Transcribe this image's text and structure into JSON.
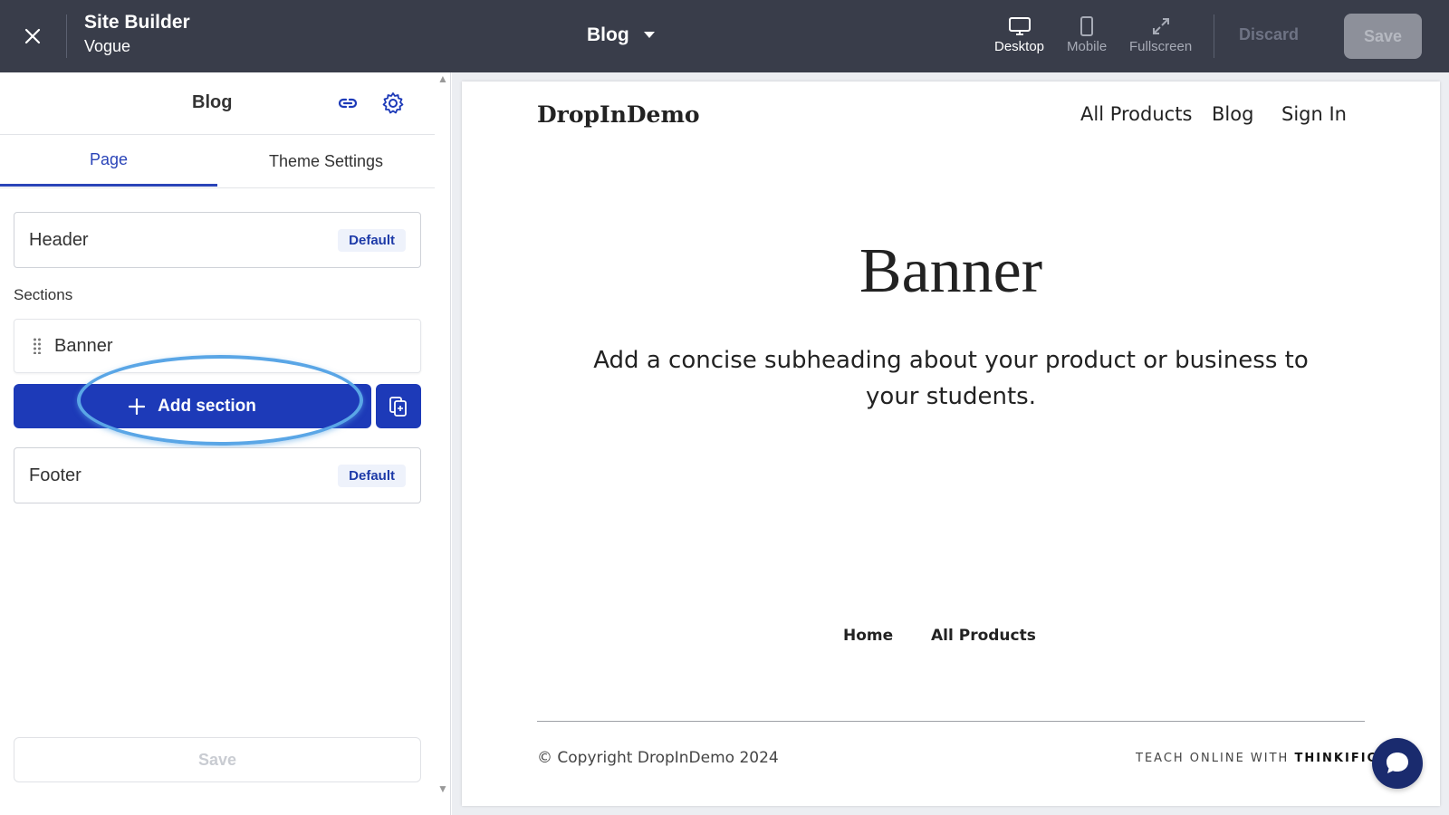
{
  "topbar": {
    "title": "Site Builder",
    "subtitle": "Vogue",
    "current_page": "Blog",
    "views": {
      "desktop": "Desktop",
      "mobile": "Mobile",
      "fullscreen": "Fullscreen"
    },
    "discard_label": "Discard",
    "save_label": "Save"
  },
  "panel": {
    "title": "Blog",
    "tabs": {
      "page": "Page",
      "theme": "Theme Settings"
    },
    "header": {
      "label": "Header",
      "badge": "Default"
    },
    "sections_label": "Sections",
    "sections": [
      {
        "label": "Banner"
      }
    ],
    "add_section_label": "Add section",
    "footer": {
      "label": "Footer",
      "badge": "Default"
    },
    "save_label": "Save"
  },
  "preview": {
    "logo": "DropInDemo",
    "nav": [
      "All Products",
      "Blog",
      "Sign In"
    ],
    "banner_heading": "Banner",
    "banner_subheading": "Add a concise subheading about your product or business to your students.",
    "footer_links": [
      "Home",
      "All Products"
    ],
    "copyright": "© Copyright DropInDemo 2024",
    "teach_prefix": "TEACH ONLINE WITH",
    "teach_brand": "THINKIFIC"
  },
  "colors": {
    "topbar_bg": "#393d4a",
    "accent": "#1d3ab8",
    "highlight": "#5aa6e6"
  }
}
